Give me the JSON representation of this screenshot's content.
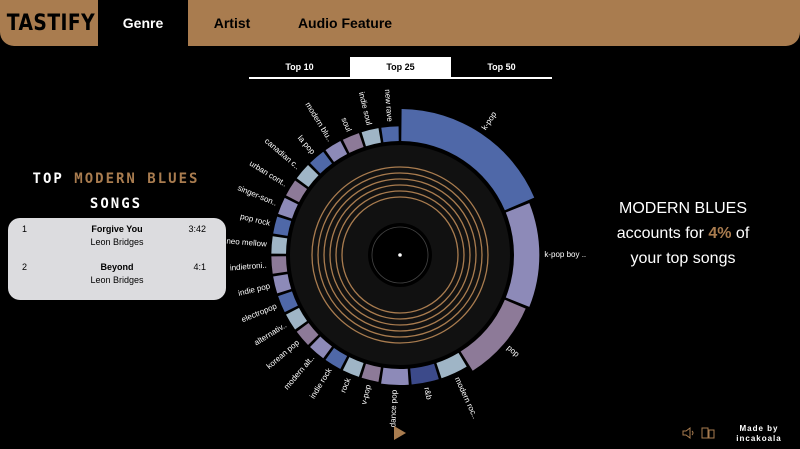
{
  "app": {
    "logo": "TASTIFY"
  },
  "nav": {
    "tabs": [
      {
        "label": "Genre",
        "active": true
      },
      {
        "label": "Artist",
        "active": false
      },
      {
        "label": "Audio Feature",
        "active": false
      }
    ]
  },
  "topn": {
    "tabs": [
      {
        "label": "Top 10",
        "active": false
      },
      {
        "label": "Top 25",
        "active": true
      },
      {
        "label": "Top 50",
        "active": false
      }
    ]
  },
  "left_panel": {
    "title_prefix": "TOP",
    "title_genre": "MODERN BLUES",
    "title_suffix": "SONGS",
    "songs": [
      {
        "rank": "1",
        "title": "Forgive You",
        "artist": "Leon Bridges",
        "duration": "3:42"
      },
      {
        "rank": "2",
        "title": "Beyond",
        "artist": "Leon Bridges",
        "duration": "4:1"
      }
    ]
  },
  "right_panel": {
    "genre": "MODERN BLUES",
    "line1_before": "accounts for ",
    "percent": "4%",
    "line1_after": " of",
    "line2": "your top songs"
  },
  "colors": {
    "accent": "#a97c4f",
    "blue": "#4f68a8",
    "lavender": "#8d8ab8",
    "mauve": "#8d7a98",
    "light_blue": "#9fb5c6",
    "dark_blue": "#3c4a8a"
  },
  "chart_data": {
    "type": "radial-bar",
    "slices": [
      {
        "label": "k-pop",
        "value": 15,
        "color": "#4f68a8"
      },
      {
        "label": "k-pop boy ..",
        "value": 10,
        "color": "#8d8ab8"
      },
      {
        "label": "pop",
        "value": 8,
        "color": "#8d7a98"
      },
      {
        "label": "modern roc..",
        "value": 3,
        "color": "#9fb5c6"
      },
      {
        "label": "r&b",
        "value": 3,
        "color": "#3c4a8a"
      },
      {
        "label": "dance pop",
        "value": 3,
        "color": "#8d8ab8"
      },
      {
        "label": "v-pop",
        "value": 2,
        "color": "#8d7a98"
      },
      {
        "label": "rock",
        "value": 2,
        "color": "#9fb5c6"
      },
      {
        "label": "indie rock",
        "value": 2,
        "color": "#4f68a8"
      },
      {
        "label": "modern alt..",
        "value": 2,
        "color": "#8d8ab8"
      },
      {
        "label": "korean pop",
        "value": 2,
        "color": "#8d7a98"
      },
      {
        "label": "alternativ..",
        "value": 2,
        "color": "#9fb5c6"
      },
      {
        "label": "electropop",
        "value": 2,
        "color": "#4f68a8"
      },
      {
        "label": "indie pop",
        "value": 2,
        "color": "#8d8ab8"
      },
      {
        "label": "indietroni..",
        "value": 2,
        "color": "#8d7a98"
      },
      {
        "label": "neo mellow",
        "value": 2,
        "color": "#9fb5c6"
      },
      {
        "label": "pop rock",
        "value": 2,
        "color": "#4f68a8"
      },
      {
        "label": "singer-son..",
        "value": 2,
        "color": "#8d8ab8"
      },
      {
        "label": "urban cont..",
        "value": 2,
        "color": "#8d7a98"
      },
      {
        "label": "canadian c..",
        "value": 2,
        "color": "#9fb5c6"
      },
      {
        "label": "la pop",
        "value": 2,
        "color": "#4f68a8"
      },
      {
        "label": "modern blu..",
        "value": 2,
        "color": "#8d8ab8"
      },
      {
        "label": "soul",
        "value": 2,
        "color": "#8d7a98"
      },
      {
        "label": "indie soul",
        "value": 2,
        "color": "#9fb5c6"
      },
      {
        "label": "new rave",
        "value": 2,
        "color": "#4f68a8"
      }
    ]
  },
  "footer": {
    "made_by_line1": "Made by",
    "made_by_line2": "incakoala"
  },
  "icons": {
    "play": "play-icon",
    "volume": "speaker-icon",
    "device": "device-icon"
  }
}
